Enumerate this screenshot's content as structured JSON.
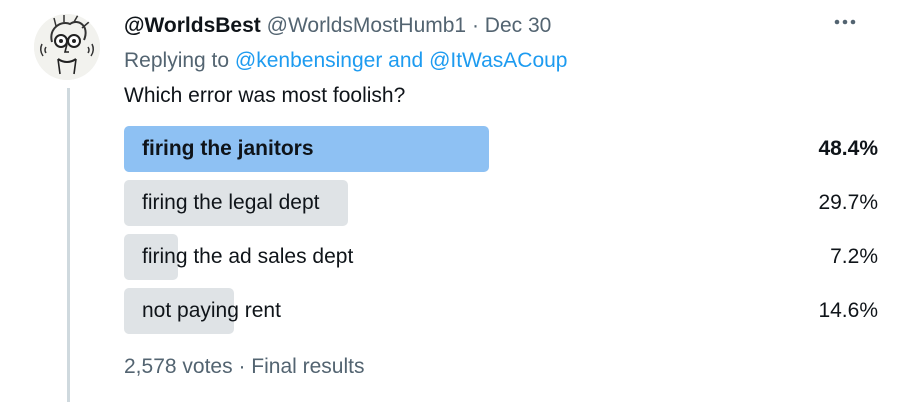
{
  "tweet": {
    "display_name": "@WorldsBest",
    "handle": "@WorldsMostHumb1",
    "separator": "·",
    "date": "Dec 30",
    "more_icon": "more-horizontal-icon",
    "replying_prefix": "Replying to",
    "reply_mention_1": "@kenbensinger",
    "reply_and": "and",
    "reply_mention_2": "@ItWasACoup",
    "text": "Which error was most foolish?"
  },
  "poll": {
    "options": [
      {
        "label": "firing the janitors",
        "percent": "48.4%",
        "share": 48.4,
        "winner": true
      },
      {
        "label": "firing the legal dept",
        "percent": "29.7%",
        "share": 29.7,
        "winner": false
      },
      {
        "label": "firing the ad sales dept",
        "percent": "7.2%",
        "share": 7.2,
        "winner": false
      },
      {
        "label": "not paying rent",
        "percent": "14.6%",
        "share": 14.6,
        "winner": false
      }
    ],
    "votes": "2,578 votes",
    "separator": "·",
    "status": "Final results"
  },
  "colors": {
    "winner_bar": "#8ec1f3",
    "other_bar": "#dfe3e6",
    "link": "#1d9bf0",
    "muted": "#536471"
  }
}
